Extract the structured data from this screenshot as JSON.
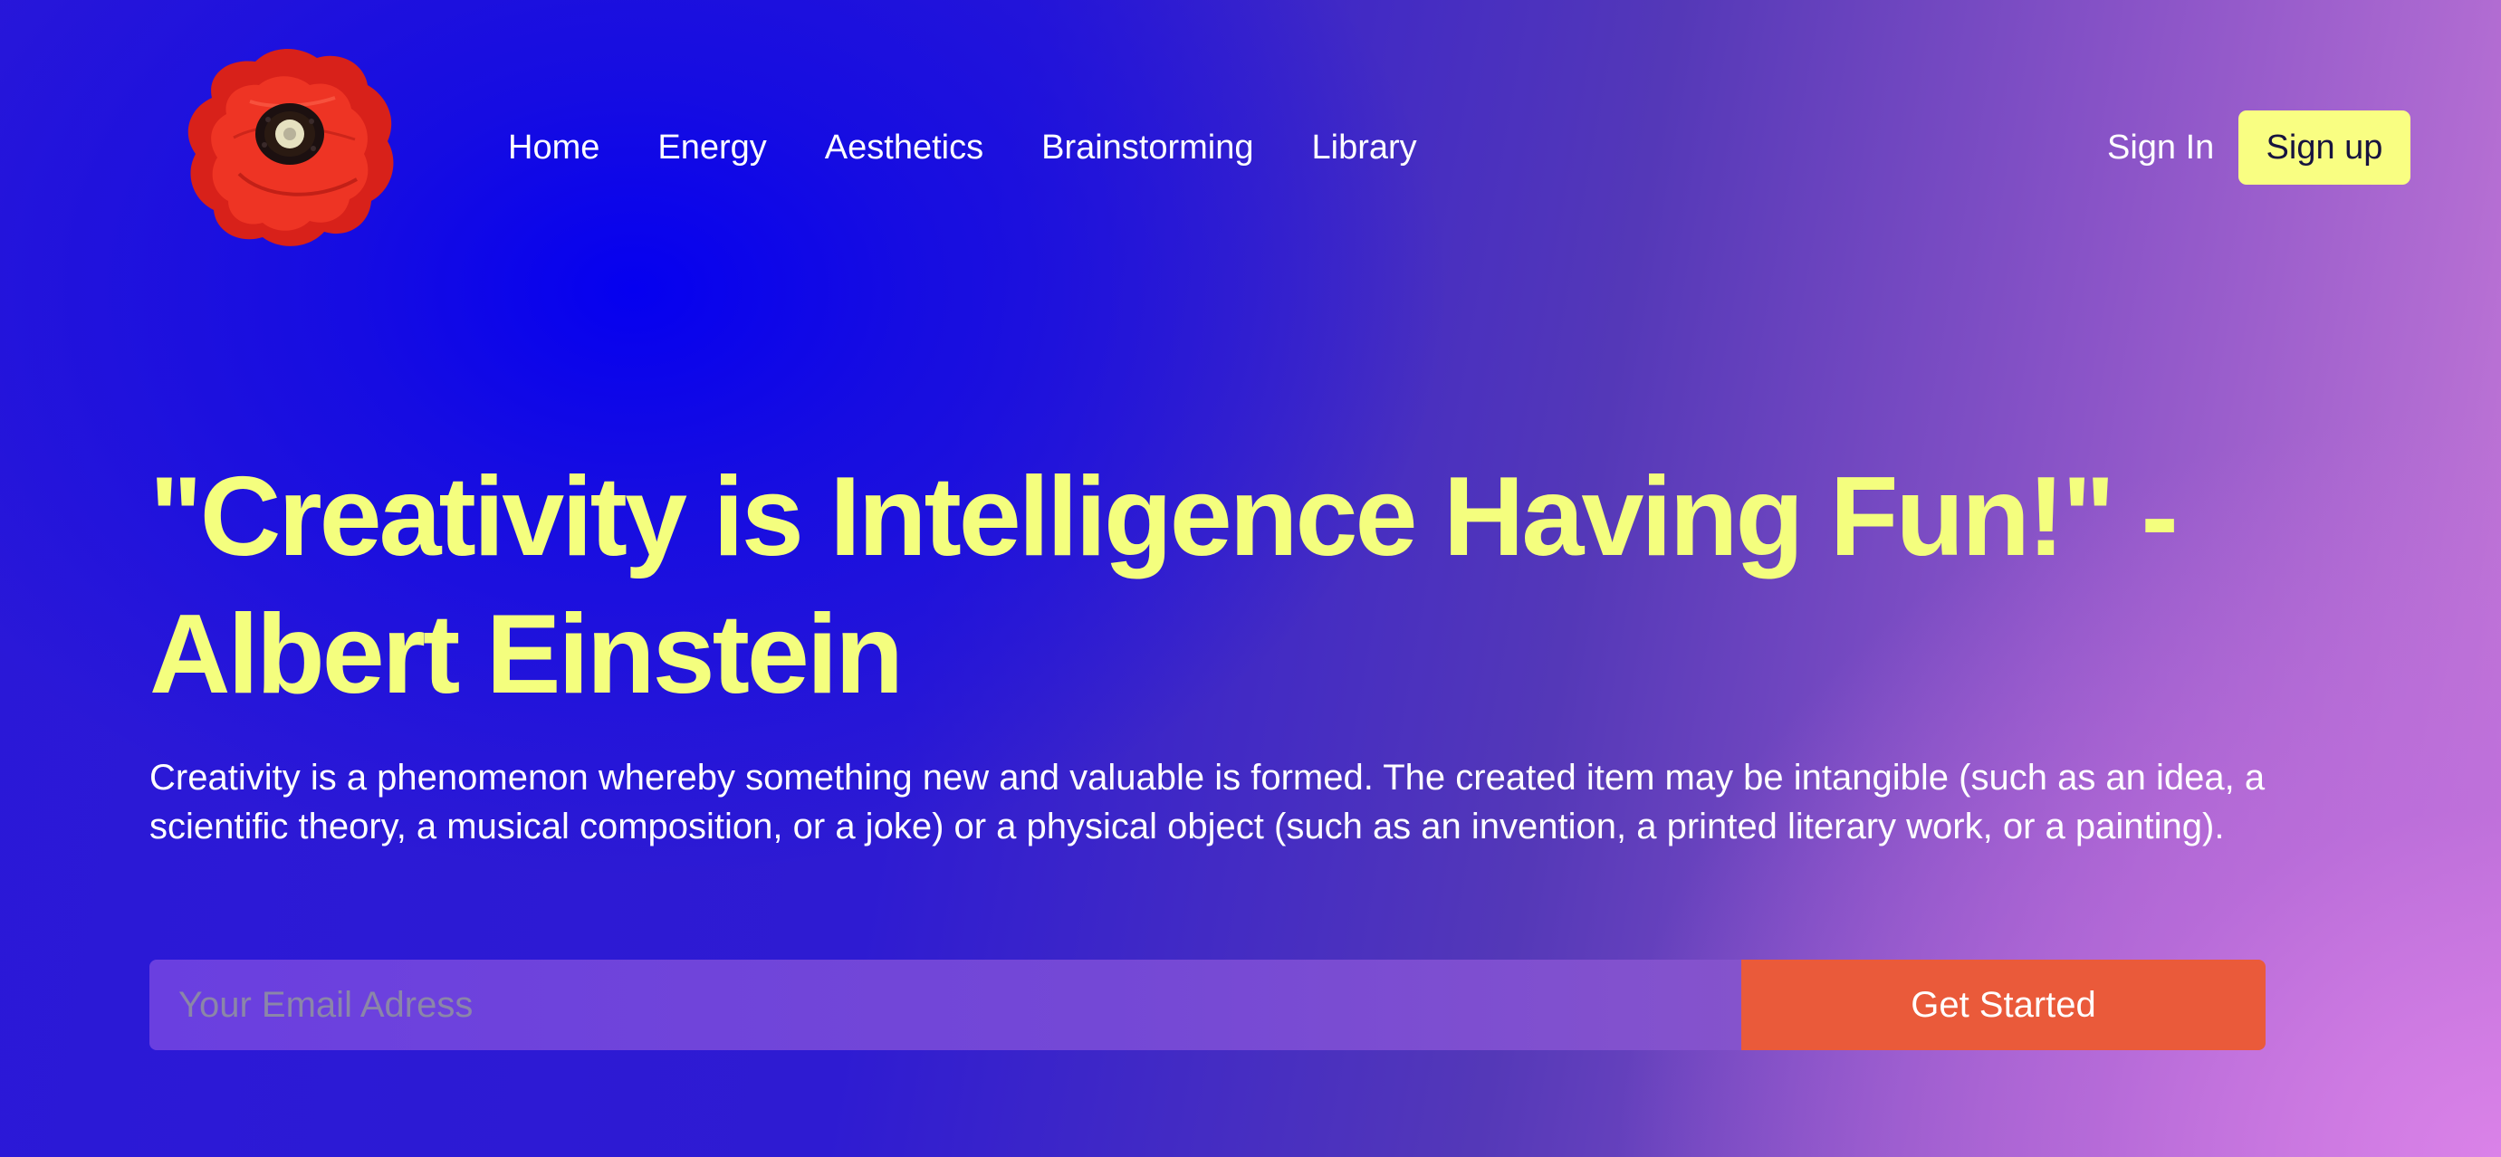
{
  "brand": {
    "logo_icon": "poppy-flower-icon",
    "colors": {
      "accent_yellow": "#f4fe7e",
      "cta_orange": "#ea5a3a",
      "text_dark": "#17133f",
      "petal_red": "#e5281c"
    }
  },
  "nav": {
    "items": [
      {
        "label": "Home"
      },
      {
        "label": "Energy"
      },
      {
        "label": "Aesthetics"
      },
      {
        "label": "Brainstorming"
      },
      {
        "label": "Library"
      }
    ]
  },
  "auth": {
    "signin_label": "Sign In",
    "signup_label": "Sign up"
  },
  "hero": {
    "headline": "\"Creativity is Intelligence Having Fun!\" - Albert Einstein",
    "description": "Creativity is a phenomenon whereby something new and valuable is formed. The created item may be intangible (such as an idea, a scientific theory, a musical composition, or a joke) or a physical object (such as an invention, a printed literary work, or a painting)."
  },
  "form": {
    "email_placeholder": "Your Email Adress",
    "email_value": "",
    "submit_label": "Get Started"
  }
}
